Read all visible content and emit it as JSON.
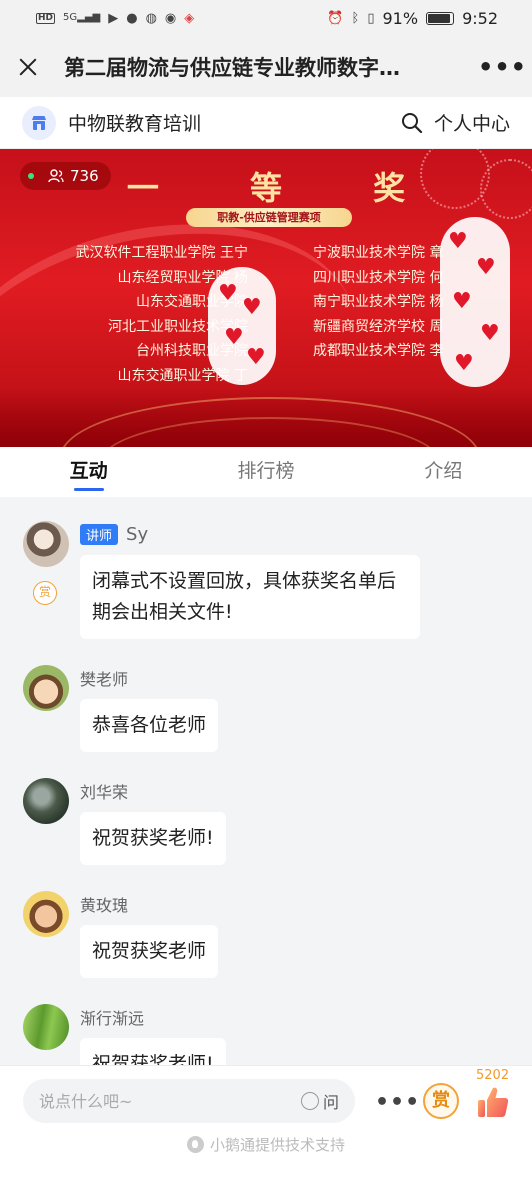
{
  "status_bar": {
    "hd_label": "HD",
    "network_label": "5G",
    "battery_percent": "91%",
    "battery_level": 0.91,
    "time": "9:52"
  },
  "title_bar": {
    "title": "第二届物流与供应链专业教师数字…",
    "more_label": "•••"
  },
  "org_bar": {
    "name": "中物联教育培训",
    "personal_center_label": "个人中心"
  },
  "banner": {
    "viewer_count": "736",
    "award_title": "一 等 奖",
    "award_subtitle": "职教-供应链管理赛项",
    "winners_left": [
      "武汉软件工程职业学院 王宁",
      "山东经贸职业学院 杨",
      "山东交通职业学院",
      "河北工业职业技术学院",
      "台州科技职业学院",
      "山东交通职业学院 丁"
    ],
    "winners_right": [
      "宁波职业技术学院 章",
      "四川职业技术学院 何",
      "南宁职业技术学院 杨",
      "新疆商贸经济学校 周",
      "成都职业技术学院 李"
    ]
  },
  "tabs": [
    {
      "label": "互动",
      "active": true
    },
    {
      "label": "排行榜",
      "active": false
    },
    {
      "label": "介绍",
      "active": false
    }
  ],
  "messages": [
    {
      "name": "Sy",
      "tag": "讲师",
      "reward_badge": "赏",
      "text": "闭幕式不设置回放，具体获奖名单后期会出相关文件!"
    },
    {
      "name": "樊老师",
      "text": "恭喜各位老师"
    },
    {
      "name": "刘华荣",
      "text": "祝贺获奖老师!"
    },
    {
      "name": "黄玫瑰",
      "text": "祝贺获奖老师"
    },
    {
      "name": "渐行渐远",
      "text": "祝贺获奖老师!"
    }
  ],
  "bottom_bar": {
    "input_placeholder": "说点什么吧~",
    "ask_label": "问",
    "more_label": "•••",
    "reward_label": "赏",
    "like_count": "5202",
    "powered_by": "小鹅通提供技术支持"
  },
  "colors": {
    "accent_blue": "#2a66f0",
    "teacher_tag": "#2f7cf6",
    "reward_orange": "#f0a13a",
    "banner_red": "#d4141c",
    "banner_gold": "#ffe3a3"
  }
}
